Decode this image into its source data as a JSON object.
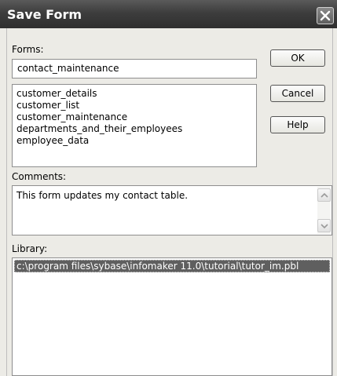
{
  "window": {
    "title": "Save Form"
  },
  "forms": {
    "label": "Forms:",
    "value": "contact_maintenance",
    "items": [
      "customer_details",
      "customer_list",
      "customer_maintenance",
      "departments_and_their_employees",
      "employee_data"
    ]
  },
  "buttons": {
    "ok": "OK",
    "cancel": "Cancel",
    "help": "Help"
  },
  "comments": {
    "label": "Comments:",
    "value": "This form updates my contact table."
  },
  "library": {
    "label": "Library:",
    "items": [
      "c:\\program files\\sybase\\infomaker 11.0\\tutorial\\tutor_im.pbl"
    ],
    "selected_index": 0
  },
  "icons": {
    "close": "close-icon",
    "scroll_up": "arrow-up-icon",
    "scroll_down": "arrow-down-icon"
  }
}
